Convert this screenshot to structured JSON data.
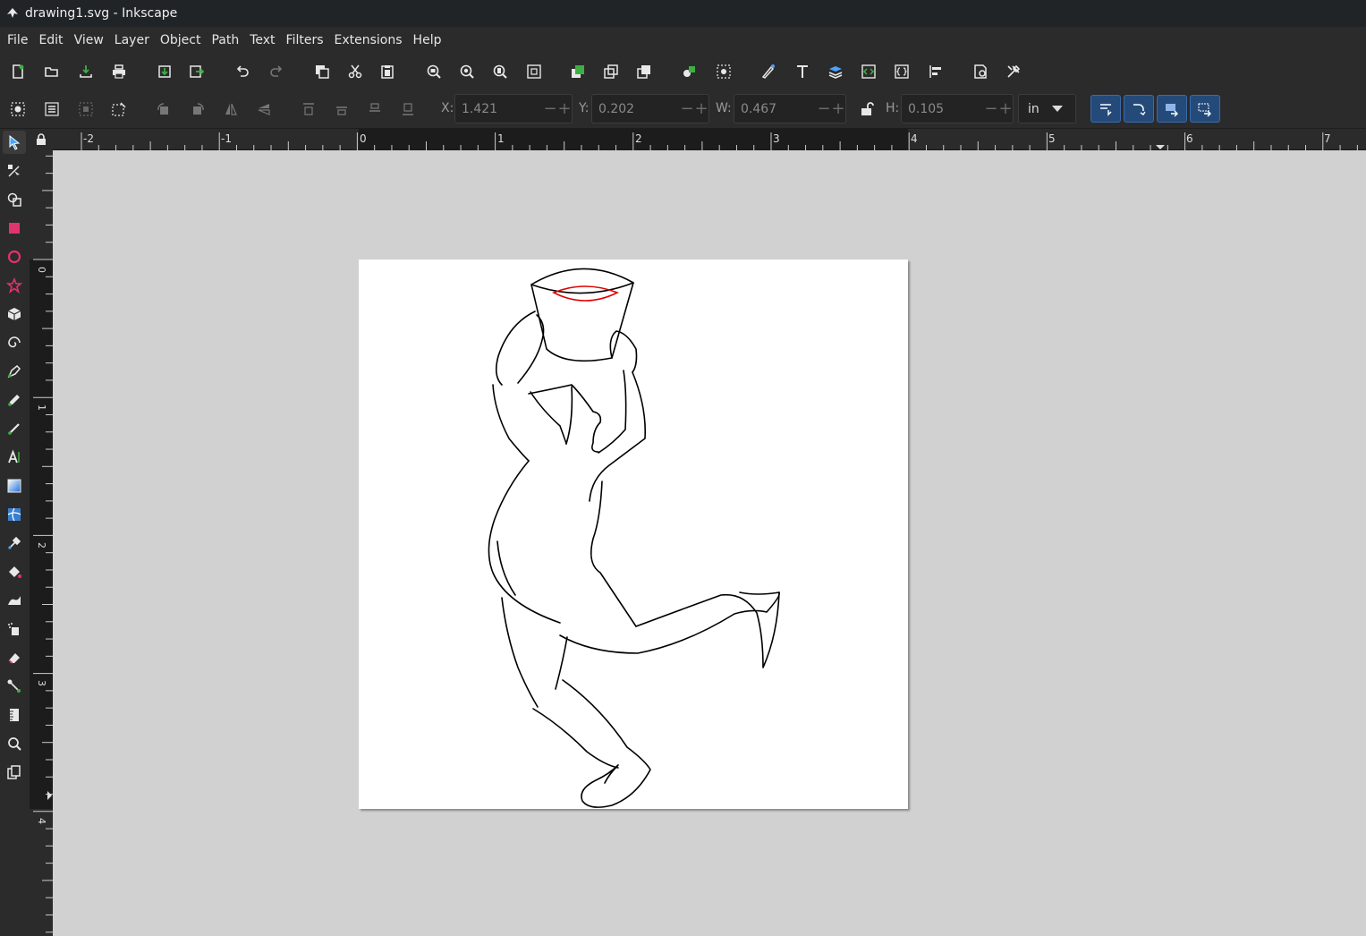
{
  "window": {
    "title": "drawing1.svg - Inkscape"
  },
  "menu": [
    "File",
    "Edit",
    "View",
    "Layer",
    "Object",
    "Path",
    "Text",
    "Filters",
    "Extensions",
    "Help"
  ],
  "transform": {
    "x_label": "X:",
    "x_value": "1.421",
    "y_label": "Y:",
    "y_value": "0.202",
    "w_label": "W:",
    "w_value": "0.467",
    "h_label": "H:",
    "h_value": "0.105",
    "unit": "in"
  },
  "ruler": {
    "top_labels": [
      "-2",
      "-1",
      "0",
      "1",
      "2",
      "3",
      "4",
      "5",
      "6",
      "7"
    ],
    "left_labels": [
      "0",
      "1",
      "2",
      "3",
      "4"
    ]
  },
  "colors": {
    "selection_stroke": "#e00000",
    "accent": "#244a7a"
  }
}
